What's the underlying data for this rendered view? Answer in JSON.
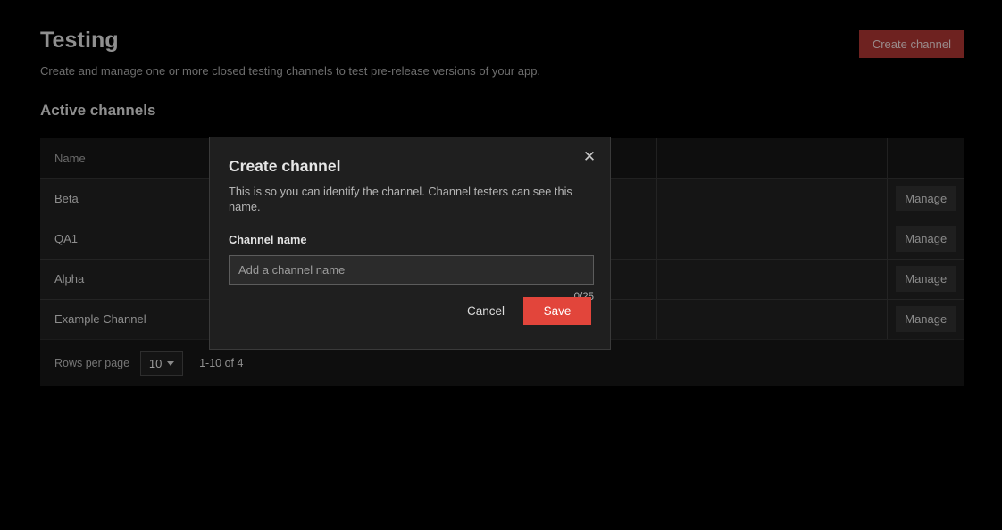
{
  "header": {
    "title": "Testing",
    "subtitle": "Create and manage one or more closed testing channels to test pre-release versions of your app.",
    "create_button_label": "Create channel"
  },
  "section": {
    "title": "Active channels"
  },
  "table": {
    "columns": [
      "Name",
      "",
      ""
    ],
    "rows": [
      {
        "name": "Beta",
        "mid": "",
        "action_label": "Manage"
      },
      {
        "name": "QA1",
        "mid": "",
        "action_label": "Manage"
      },
      {
        "name": "Alpha",
        "mid": "",
        "action_label": "Manage"
      },
      {
        "name": "Example Channel",
        "mid": "",
        "action_label": "Manage"
      }
    ]
  },
  "pagination": {
    "rows_per_page_label": "Rows per page",
    "rows_per_page_value": "10",
    "range_label": "1-10 of 4"
  },
  "modal": {
    "title": "Create channel",
    "description": "This is so you can identify the channel. Channel testers can see this name.",
    "field_label": "Channel name",
    "input_value": "",
    "input_placeholder": "Add a channel name",
    "char_count": "0/25",
    "cancel_label": "Cancel",
    "save_label": "Save",
    "close_icon": "close-icon",
    "close_glyph": "✕"
  },
  "colors": {
    "page_background": "#000000",
    "card_background": "#0e0e0e",
    "row_background": "#151515",
    "modal_background": "#1f1f1f",
    "accent_red": "#e2453b",
    "create_button_red": "#6e2220"
  }
}
